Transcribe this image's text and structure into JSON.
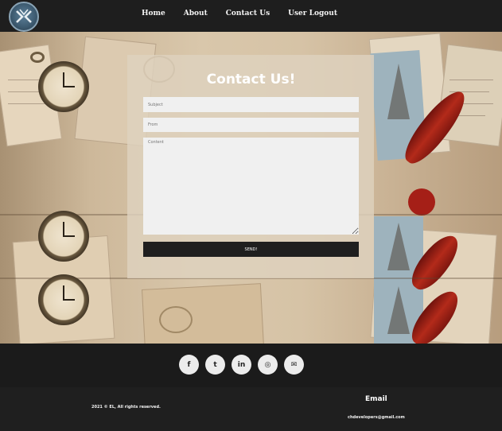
{
  "nav": {
    "links": [
      "Home",
      "About",
      "Contact Us",
      "User Logout"
    ]
  },
  "contact": {
    "title": "Contact Us!",
    "subject_placeholder": "Subject",
    "from_placeholder": "From",
    "content_placeholder": "Content",
    "send_label": "SEND!"
  },
  "social": {
    "icons": [
      {
        "name": "facebook-icon",
        "glyph": "f"
      },
      {
        "name": "twitter-icon",
        "glyph": "t"
      },
      {
        "name": "linkedin-icon",
        "glyph": "in"
      },
      {
        "name": "instagram-icon",
        "glyph": "◎"
      },
      {
        "name": "envelope-icon",
        "glyph": "✉"
      }
    ]
  },
  "footer": {
    "copyright": "2021 © EL, All rights reserved.",
    "email_heading": "Email",
    "email_address": "chdevelopers@gmail.com"
  },
  "colors": {
    "navbar": "#1e1e1e",
    "footer": "#1f1f1f",
    "send_button": "#1f1f1f",
    "field": "#f0f0f0"
  }
}
